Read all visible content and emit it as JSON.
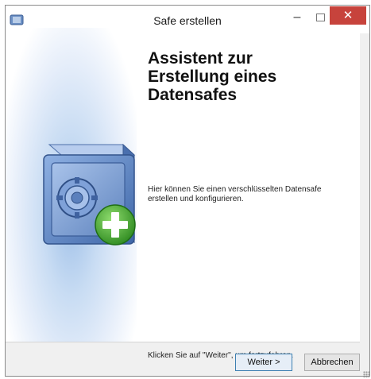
{
  "window": {
    "title": "Safe erstellen",
    "minimize_glyph": "–",
    "close_glyph": "✕"
  },
  "wizard": {
    "heading": "Assistent zur Erstellung eines Datensafes",
    "description": "Hier können Sie einen verschlüsselten Datensafe erstellen und konfigurieren.",
    "hint": "Klicken Sie auf \"Weiter\", um fortzufahren.",
    "banner_icon": "safe-add-icon"
  },
  "buttons": {
    "next_label": "Weiter >",
    "cancel_label": "Abbrechen"
  },
  "colors": {
    "close_button": "#c7433c",
    "banner_gradient": "#9fc0e8",
    "safe_body": "#5b86c4",
    "plus_badge": "#3b9a2b"
  }
}
